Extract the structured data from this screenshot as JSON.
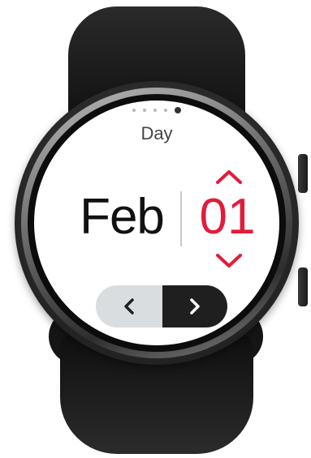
{
  "screen": {
    "title": "Day",
    "pager": {
      "total": 5,
      "active_index": 4
    }
  },
  "date_picker": {
    "month": "Feb",
    "day": "01",
    "day_color": "#e31b3b",
    "increment_icon": "chevron-up-icon",
    "decrement_icon": "chevron-down-icon"
  },
  "navigation": {
    "prev_icon": "chevron-left-icon",
    "next_icon": "chevron-right-icon",
    "prev_bg": "#d9dde0",
    "next_bg": "#1f1f1f"
  }
}
